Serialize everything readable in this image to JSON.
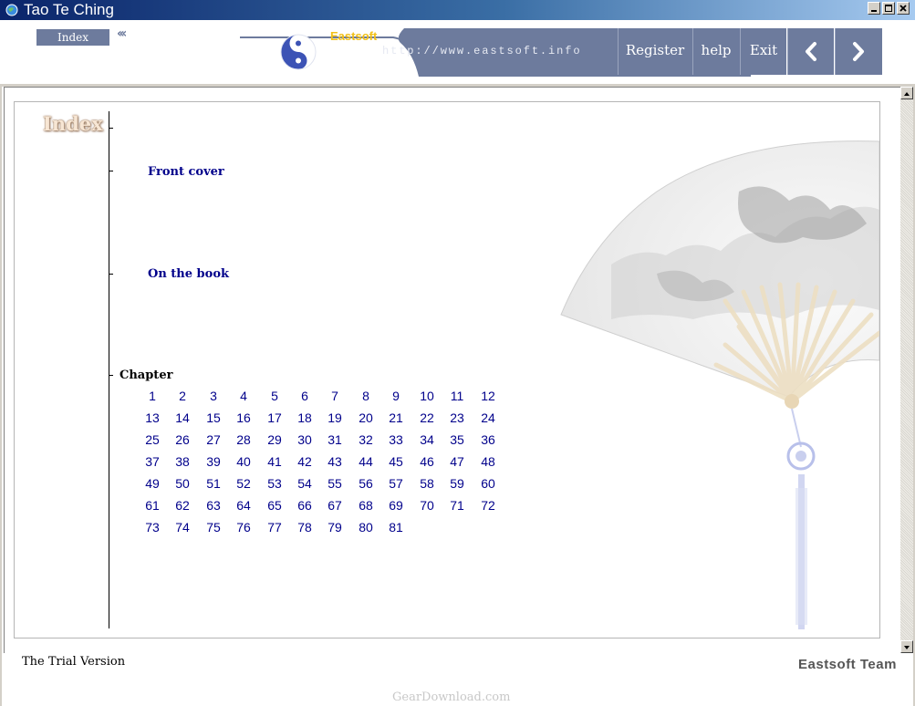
{
  "window": {
    "title": "Tao Te Ching",
    "controls": {
      "minimize": "minimize-icon",
      "maximize": "maximize-icon",
      "close": "close-icon"
    }
  },
  "header": {
    "index_tab": "Index",
    "brand": "Eastsoft",
    "url": "http://www.eastsoft.info",
    "nav": {
      "register": "Register",
      "help": "help",
      "exit": "Exit",
      "prev": "‹",
      "next": "›"
    },
    "colors": {
      "bar": "#6d7b9d",
      "brand": "#f2c019"
    }
  },
  "index": {
    "heading": "Index",
    "front_cover": "Front cover",
    "on_the_book": "On the book",
    "chapter_label": "Chapter",
    "chapters": [
      [
        "1",
        "2",
        "3",
        "4",
        "5",
        "6",
        "7",
        "8",
        "9",
        "10",
        "11",
        "12"
      ],
      [
        "13",
        "14",
        "15",
        "16",
        "17",
        "18",
        "19",
        "20",
        "21",
        "22",
        "23",
        "24"
      ],
      [
        "25",
        "26",
        "27",
        "28",
        "29",
        "30",
        "31",
        "32",
        "33",
        "34",
        "35",
        "36"
      ],
      [
        "37",
        "38",
        "39",
        "40",
        "41",
        "42",
        "43",
        "44",
        "45",
        "46",
        "47",
        "48"
      ],
      [
        "49",
        "50",
        "51",
        "52",
        "53",
        "54",
        "55",
        "56",
        "57",
        "58",
        "59",
        "60"
      ],
      [
        "61",
        "62",
        "63",
        "64",
        "65",
        "66",
        "67",
        "68",
        "69",
        "70",
        "71",
        "72"
      ],
      [
        "73",
        "74",
        "75",
        "76",
        "77",
        "78",
        "79",
        "80",
        "81"
      ]
    ],
    "link_color": "#00008b"
  },
  "footer": {
    "trial": "The Trial Version",
    "team": "Eastsoft Team",
    "watermark": "GearDownload.com"
  }
}
